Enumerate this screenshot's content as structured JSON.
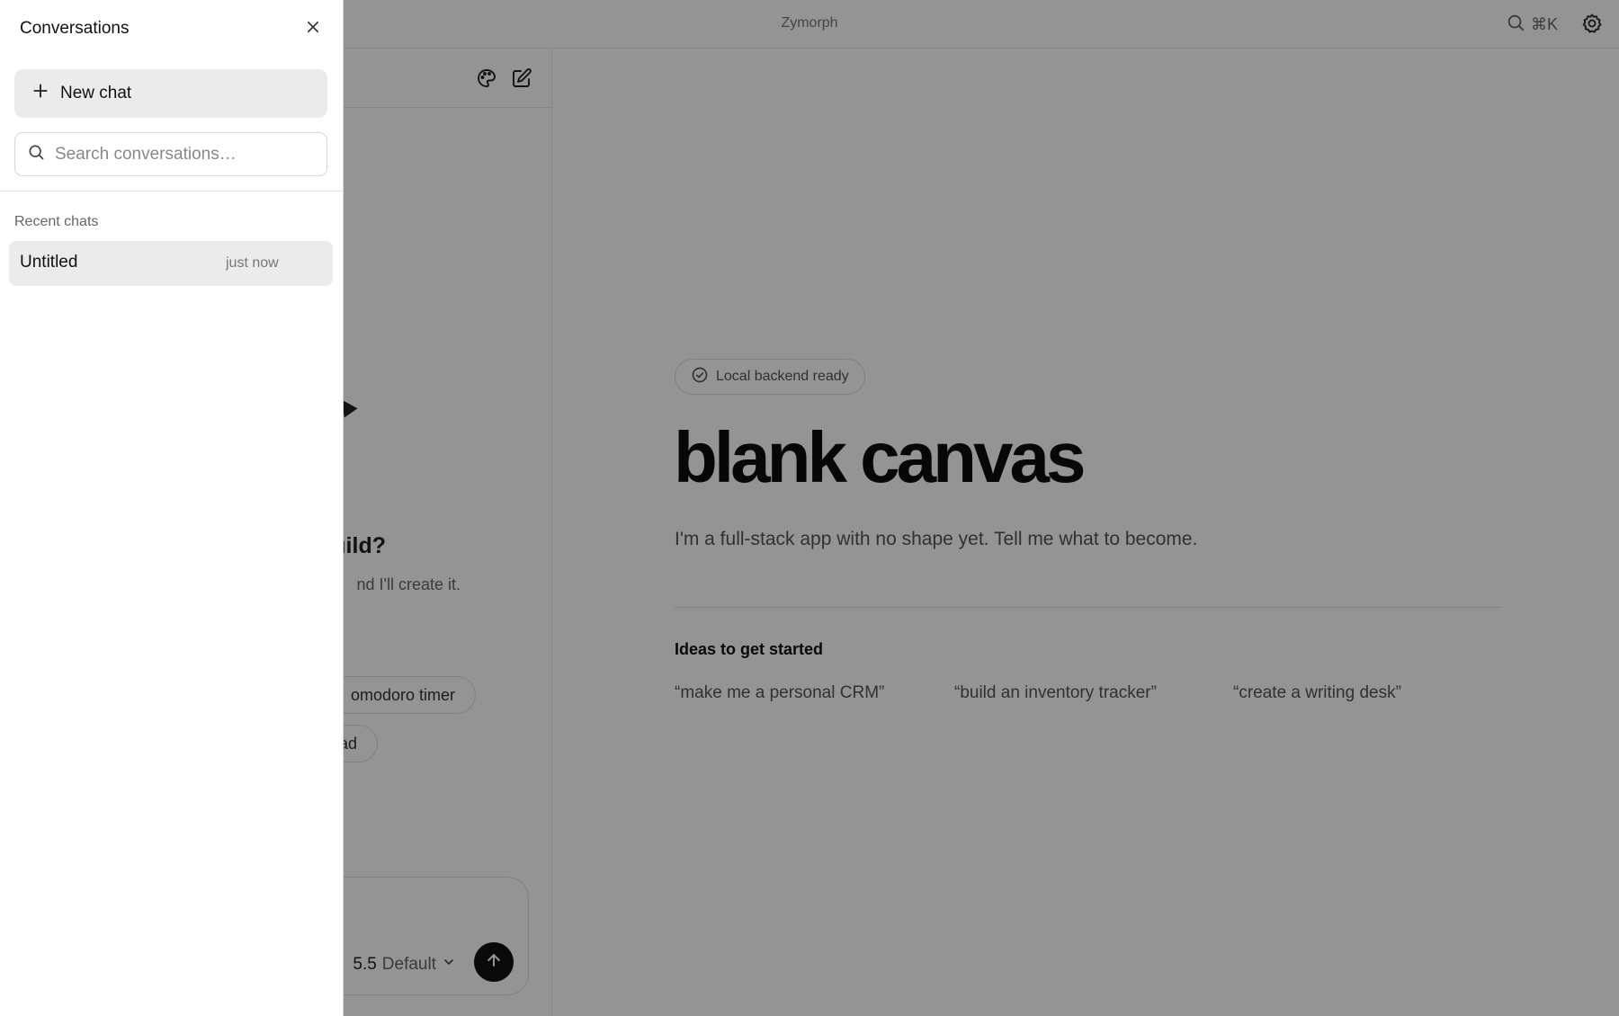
{
  "app": {
    "title": "Zymorph",
    "search_shortcut": "⌘K"
  },
  "drawer": {
    "title": "Conversations",
    "new_chat_label": "New chat",
    "search_placeholder": "Search conversations…",
    "search_value": "",
    "section_label": "Recent chats",
    "items": [
      {
        "title": "Untitled",
        "time": "just now"
      }
    ]
  },
  "chat_pane": {
    "heading_visible": "uild?",
    "subtext_visible": "nd I'll create it.",
    "suggestions_visible": [
      "omodoro timer",
      "ad"
    ],
    "model_version_visible": "5.5",
    "model_mode": "Default"
  },
  "canvas": {
    "status": "Local backend ready",
    "title": "blank canvas",
    "tagline": "I'm a full-stack app with no shape yet. Tell me what to become.",
    "ideas_heading": "Ideas to get started",
    "ideas": [
      "“make me a personal CRM”",
      "“build an inventory tracker”",
      "“create a writing desk”"
    ]
  },
  "colors": {
    "scrim": "rgba(0,0,0,0.42)",
    "drawer_bg": "#ffffff",
    "selected_bg": "#ebebeb",
    "send_button": "#111111"
  },
  "icons": {
    "close": "close-icon",
    "plus": "plus-icon",
    "search": "search-icon",
    "settings": "gear-icon",
    "palette": "palette-icon",
    "edit": "edit-icon",
    "status": "check-circle-icon",
    "send": "arrow-up-icon",
    "chevron": "chevron-down-icon"
  }
}
